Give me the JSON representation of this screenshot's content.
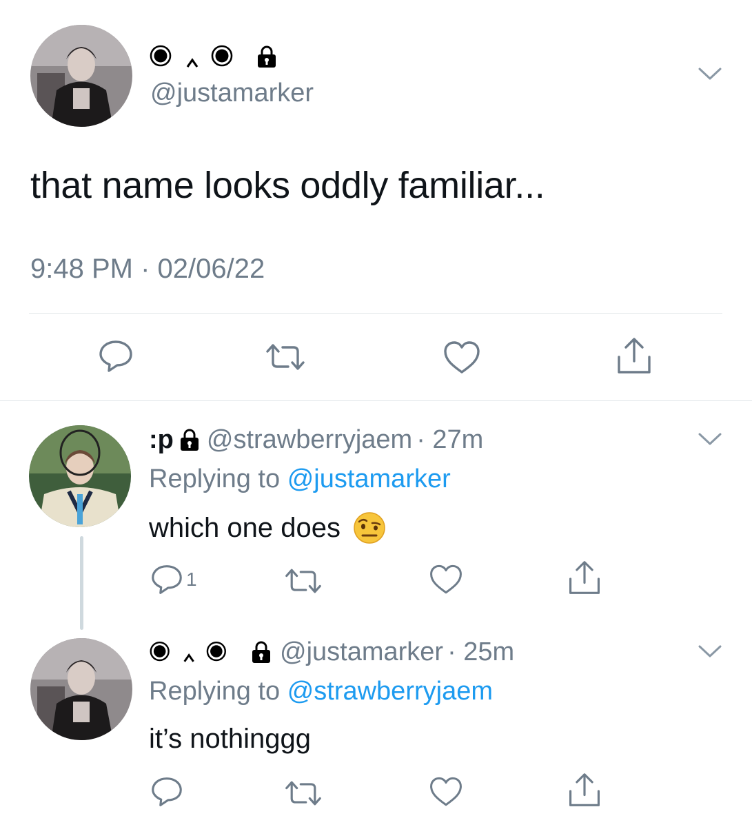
{
  "main_tweet": {
    "display_name_glyphs": "◉ ‸ ◉",
    "handle": "@justamarker",
    "text": "that name looks oddly familiar...",
    "timestamp": "9:48 PM · 02/06/22",
    "icons": [
      "reply-icon",
      "retweet-icon",
      "like-icon",
      "share-icon"
    ]
  },
  "replies": [
    {
      "display_name": ":p",
      "handle": "@strawberryjaem",
      "time": "· 27m",
      "replying_label": "Replying to",
      "replying_to": "@justamarker",
      "text": "which one does",
      "emoji": "face-with-raised-eyebrow",
      "reply_count": "1"
    },
    {
      "display_name_glyphs": "◉ ‸ ◉",
      "handle": "@justamarker",
      "time": "· 25m",
      "replying_label": "Replying to",
      "replying_to": "@strawberryjaem",
      "text": "it’s nothinggg"
    }
  ],
  "colors": {
    "text": "#0f1419",
    "secondary": "#6e7c8a",
    "link": "#1d9bf0",
    "divider": "#e3e7ea"
  }
}
